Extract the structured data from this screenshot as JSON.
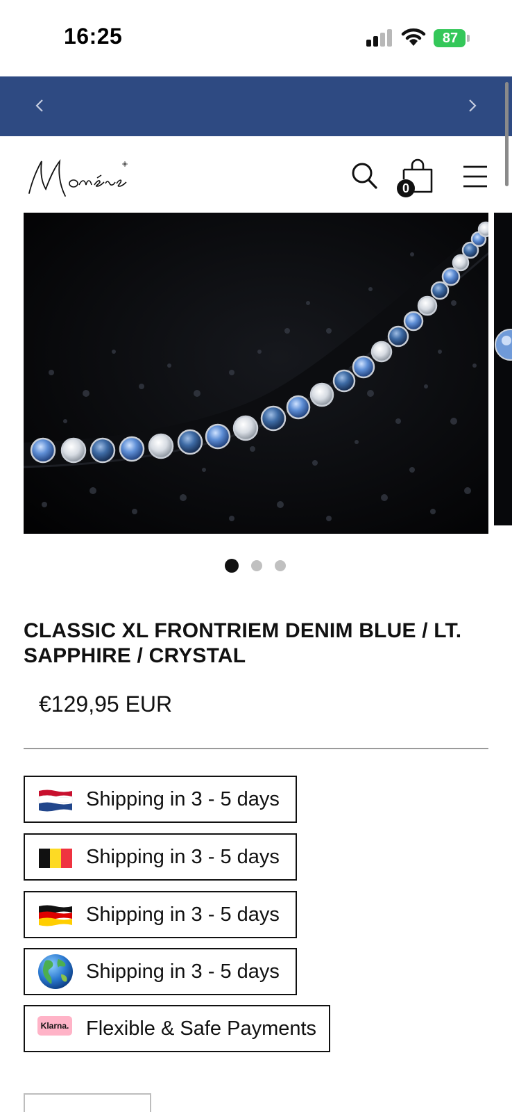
{
  "status_bar": {
    "time": "16:25",
    "battery": "87",
    "icons": [
      "signal-icon",
      "wifi-icon",
      "battery-charging-icon"
    ]
  },
  "announcement": {
    "background": "#2e4a82",
    "prev_icon": "chevron-left-icon",
    "next_icon": "chevron-right-icon"
  },
  "header": {
    "logo_alt": "Monère",
    "cart_count": "0",
    "icons": [
      "search-icon",
      "shopping-bag-icon",
      "hamburger-menu-icon"
    ]
  },
  "gallery": {
    "slide_count": 3,
    "active_slide": 1
  },
  "product": {
    "title": "CLASSIC XL FRONTRIEM DENIM BLUE / LT. SAPPHIRE / CRYSTAL",
    "price": "€129,95 EUR"
  },
  "badges": [
    {
      "icon": "netherlands-flag-icon",
      "label": "Shipping in 3 - 5 days"
    },
    {
      "icon": "belgium-flag-icon",
      "label": "Shipping in 3 - 5 days"
    },
    {
      "icon": "germany-flag-icon",
      "label": "Shipping in 3 - 5 days"
    },
    {
      "icon": "globe-icon",
      "label": "Shipping in 3 - 5 days"
    },
    {
      "icon": "klarna-icon",
      "label": "Flexible & Safe Payments",
      "icon_text": "Klarna."
    }
  ]
}
